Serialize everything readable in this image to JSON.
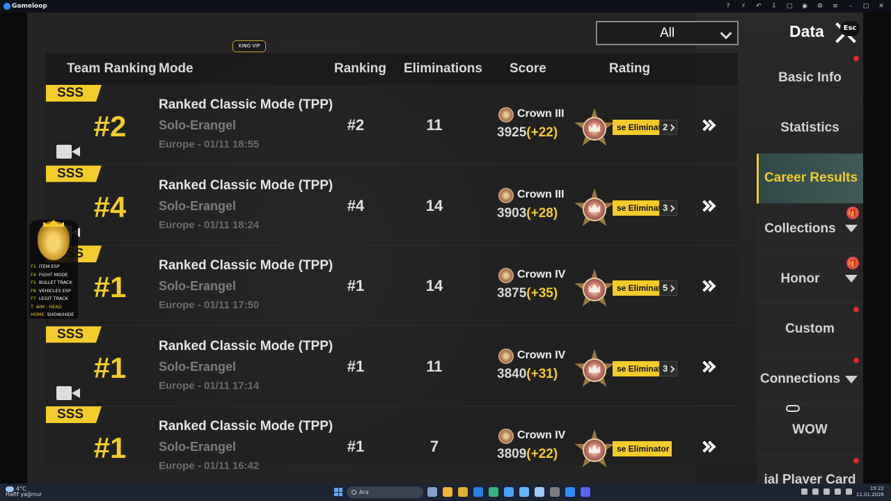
{
  "window": {
    "title": "Gameloop"
  },
  "titlebar_icons": [
    "help-icon",
    "boost-icon",
    "undo-icon",
    "minimize-icon",
    "restore-icon",
    "screen-record-icon",
    "settings-icon",
    "menu-icon",
    "window-minimize-icon",
    "window-maximize-icon",
    "window-close-icon"
  ],
  "header": {
    "filter_selected": "All",
    "title": "Data",
    "esc_label": "Esc",
    "vip_tag": "KING VIP"
  },
  "columns": {
    "team_ranking": "Team Ranking",
    "mode": "Mode",
    "ranking": "Ranking",
    "eliminations": "Eliminations",
    "score": "Score",
    "rating": "Rating"
  },
  "rows": [
    {
      "grade": "SSS",
      "team_rank": "#2",
      "mode": "Ranked Classic Mode (TPP)",
      "submode": "Solo-Erangel",
      "when": "Europe - 01/11 18:55",
      "ranking": "#2",
      "eliminations": "11",
      "tier": "Crown III",
      "points": "3925",
      "delta": "(+22)",
      "badge": "se Eliminator",
      "badge_count": "2",
      "has_video": true
    },
    {
      "grade": "SSS",
      "team_rank": "#4",
      "mode": "Ranked Classic Mode (TPP)",
      "submode": "Solo-Erangel",
      "when": "Europe - 01/11 18:24",
      "ranking": "#4",
      "eliminations": "14",
      "tier": "Crown III",
      "points": "3903",
      "delta": "(+28)",
      "badge": "se Eliminator",
      "badge_count": "3",
      "has_video": true
    },
    {
      "grade": "SSS",
      "team_rank": "#1",
      "mode": "Ranked Classic Mode (TPP)",
      "submode": "Solo-Erangel",
      "when": "Europe - 01/11 17:50",
      "ranking": "#1",
      "eliminations": "14",
      "tier": "Crown IV",
      "points": "3875",
      "delta": "(+35)",
      "badge": "se Eliminator",
      "badge_count": "5",
      "has_video": false
    },
    {
      "grade": "SSS",
      "team_rank": "#1",
      "mode": "Ranked Classic Mode (TPP)",
      "submode": "Solo-Erangel",
      "when": "Europe - 01/11 17:14",
      "ranking": "#1",
      "eliminations": "11",
      "tier": "Crown IV",
      "points": "3840",
      "delta": "(+31)",
      "badge": "se Eliminator",
      "badge_count": "3",
      "has_video": true
    },
    {
      "grade": "SSS",
      "team_rank": "#1",
      "mode": "Ranked Classic Mode (TPP)",
      "submode": "Solo-Erangel",
      "when": "Europe - 01/11 16:42",
      "ranking": "#1",
      "eliminations": "7",
      "tier": "Crown IV",
      "points": "3809",
      "delta": "(+22)",
      "badge": "se Eliminator",
      "badge_count": "",
      "has_video": false
    }
  ],
  "nav": [
    {
      "label": "Basic Info",
      "active": false,
      "marker": "dot"
    },
    {
      "label": "Statistics",
      "active": false,
      "marker": ""
    },
    {
      "label": "Career Results",
      "active": true,
      "marker": ""
    },
    {
      "label": "Collections",
      "active": false,
      "marker": "gift",
      "expand": true
    },
    {
      "label": "Honor",
      "active": false,
      "marker": "gift",
      "expand": true
    },
    {
      "label": "Custom",
      "active": false,
      "marker": "dot"
    },
    {
      "label": "Connections",
      "active": false,
      "marker": "dot",
      "expand": true
    },
    {
      "label": "WOW",
      "active": false,
      "marker": ""
    },
    {
      "label": "ial Player Card",
      "active": false,
      "marker": "dot"
    }
  ],
  "overlay_menu": [
    {
      "key": "F1",
      "label": "ITEM ESP"
    },
    {
      "key": "F4",
      "label": "FIGHT MODE"
    },
    {
      "key": "F5",
      "label": "BULLET TRACK"
    },
    {
      "key": "F6",
      "label": "VEHICLES ESP"
    },
    {
      "key": "F7",
      "label": "LEGIT TRACK"
    },
    {
      "key": "T",
      "label": "AIM : HEAD"
    },
    {
      "key": "HOME",
      "label": "SHOW/HIDE"
    }
  ],
  "taskbar": {
    "temperature": "4°C",
    "weather": "Hafif yağmur",
    "search_placeholder": "Ara",
    "time": "19:22",
    "date": "11.01.2026"
  },
  "colors": {
    "accent": "#f3cb2b",
    "background": "#242424",
    "taskbar": "#1c2333"
  }
}
